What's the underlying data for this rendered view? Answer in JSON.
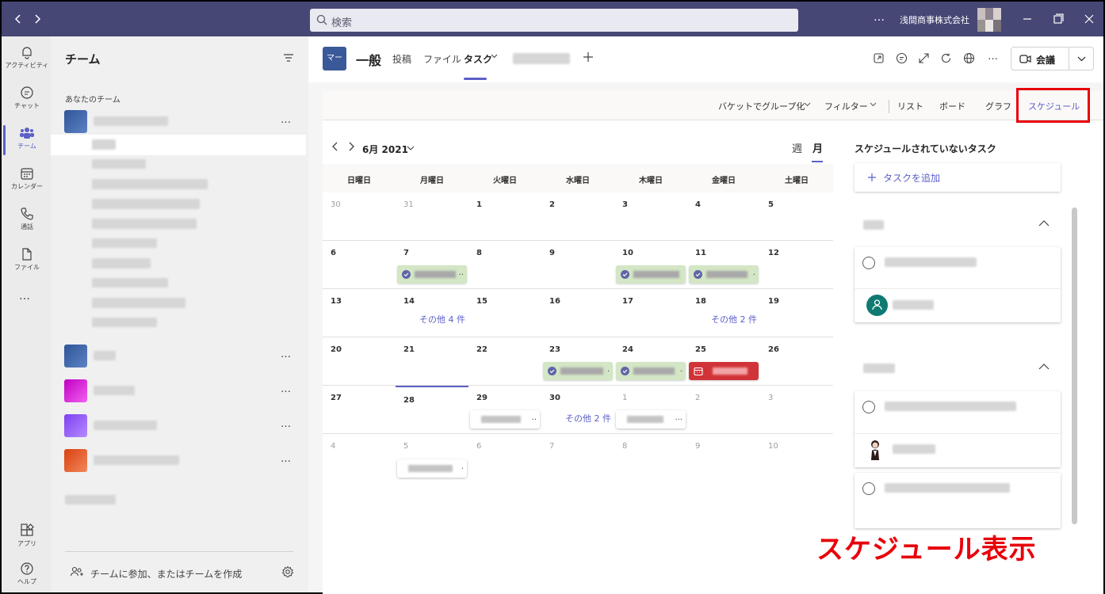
{
  "titlebar": {
    "search_placeholder": "検索",
    "more": "…",
    "org_name": "浅間商事株式会社"
  },
  "rail": {
    "items": [
      {
        "label": "アクティビティ",
        "icon": "bell-icon"
      },
      {
        "label": "チャット",
        "icon": "chat-icon"
      },
      {
        "label": "チーム",
        "icon": "teams-icon"
      },
      {
        "label": "カレンダー",
        "icon": "calendar-icon"
      },
      {
        "label": "通話",
        "icon": "phone-icon"
      },
      {
        "label": "ファイル",
        "icon": "file-icon"
      }
    ],
    "more": "…",
    "apps_label": "アプリ",
    "help_label": "ヘルプ"
  },
  "teams_pane": {
    "title": "チーム",
    "section_label": "あなたのチーム",
    "more": "…",
    "join_label": "チームに参加、またはチームを作成"
  },
  "channel": {
    "badge": "マー",
    "name": "一般",
    "tabs": [
      "投稿",
      "ファイル",
      "タスク"
    ],
    "meet_label": "会議"
  },
  "planner": {
    "toolbar": {
      "group_by": "バケットでグループ化",
      "filter": "フィルター",
      "list": "リスト",
      "board": "ボード",
      "chart": "グラフ",
      "schedule": "スケジュール"
    },
    "calendar": {
      "month_label": "6月 2021",
      "view_week": "週",
      "view_month": "月",
      "weekdays": [
        "日曜日",
        "月曜日",
        "火曜日",
        "水曜日",
        "木曜日",
        "金曜日",
        "土曜日"
      ],
      "weeks": [
        [
          "30",
          "31",
          "1",
          "2",
          "3",
          "4",
          "5"
        ],
        [
          "6",
          "7",
          "8",
          "9",
          "10",
          "11",
          "12"
        ],
        [
          "13",
          "14",
          "15",
          "16",
          "17",
          "18",
          "19"
        ],
        [
          "20",
          "21",
          "22",
          "23",
          "24",
          "25",
          "26"
        ],
        [
          "27",
          "28",
          "29",
          "30",
          "1",
          "2",
          "3"
        ],
        [
          "4",
          "5",
          "6",
          "7",
          "8",
          "9",
          "10"
        ]
      ],
      "more_links": [
        "その他 4 件",
        "その他 2 件",
        "その他 2 件"
      ],
      "colors": {
        "task_green": "#d3e6c5",
        "task_red": "#d13438",
        "accent": "#5b5fc7"
      }
    },
    "unscheduled": {
      "title": "スケジュールされていないタスク",
      "add_task": "タスクを追加"
    }
  },
  "annotation": "スケジュール表示"
}
